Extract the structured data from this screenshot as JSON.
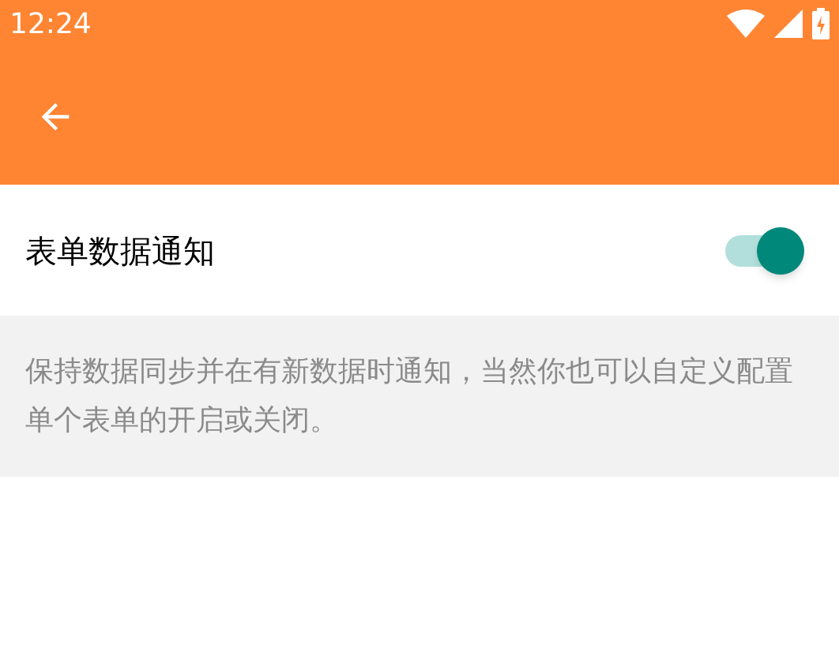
{
  "status_bar": {
    "time": "12:24"
  },
  "setting": {
    "label": "表单数据通知",
    "on": true
  },
  "description": "保持数据同步并在有新数据时通知，当然你也可以自定义配置单个表单的开启或关闭。"
}
